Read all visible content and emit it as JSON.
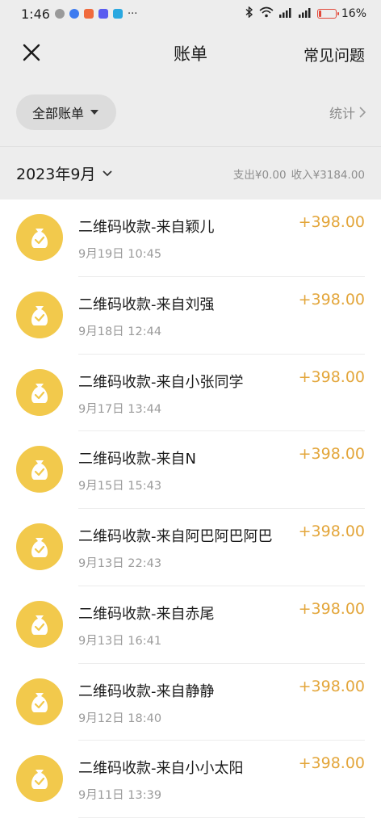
{
  "status_bar": {
    "time": "1:46",
    "more": "···",
    "network": "⁴ᴳ",
    "battery_percent": "16%",
    "battery_level": 0.16
  },
  "nav": {
    "title": "账单",
    "faq": "常见问题"
  },
  "filter": {
    "all_bills": "全部账单",
    "stats": "统计"
  },
  "month": {
    "label": "2023年9月",
    "expense": "支出¥0.00",
    "income": "收入¥3184.00"
  },
  "colors": {
    "accent_amount": "#e3a63b",
    "avatar_bg": "#f2c94c"
  },
  "transactions": [
    {
      "title": "二维码收款-来自颖儿",
      "time": "9月19日 10:45",
      "amount": "+398.00",
      "icon": "money-bag-icon"
    },
    {
      "title": "二维码收款-来自刘强",
      "time": "9月18日 12:44",
      "amount": "+398.00",
      "icon": "money-bag-icon"
    },
    {
      "title": "二维码收款-来自小张同学",
      "time": "9月17日 13:44",
      "amount": "+398.00",
      "icon": "money-bag-icon"
    },
    {
      "title": "二维码收款-来自N",
      "time": "9月15日 15:43",
      "amount": "+398.00",
      "icon": "money-bag-icon"
    },
    {
      "title": "二维码收款-来自阿巴阿巴阿巴",
      "time": "9月13日 22:43",
      "amount": "+398.00",
      "icon": "money-bag-icon"
    },
    {
      "title": "二维码收款-来自赤尾",
      "time": "9月13日 16:41",
      "amount": "+398.00",
      "icon": "money-bag-icon"
    },
    {
      "title": "二维码收款-来自静静",
      "time": "9月12日 18:40",
      "amount": "+398.00",
      "icon": "money-bag-icon"
    },
    {
      "title": "二维码收款-来自小小太阳",
      "time": "9月11日 13:39",
      "amount": "+398.00",
      "icon": "money-bag-icon"
    }
  ]
}
